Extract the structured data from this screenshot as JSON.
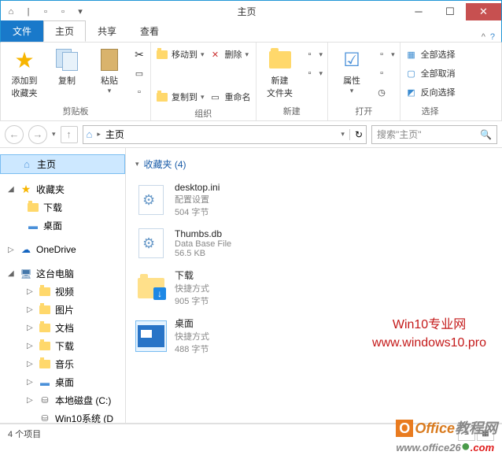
{
  "window": {
    "title": "主页"
  },
  "tabs": {
    "file": "文件",
    "home": "主页",
    "share": "共享",
    "view": "查看"
  },
  "ribbon": {
    "clipboard": {
      "label": "剪贴板",
      "pin": "添加到\n收藏夹",
      "copy": "复制",
      "paste": "粘贴"
    },
    "organize": {
      "label": "组织",
      "moveto": "移动到",
      "copyto": "复制到",
      "delete": "删除",
      "rename": "重命名"
    },
    "new": {
      "label": "新建",
      "newfolder": "新建\n文件夹"
    },
    "open": {
      "label": "打开",
      "properties": "属性"
    },
    "select": {
      "label": "选择",
      "selectall": "全部选择",
      "selectnone": "全部取消",
      "invert": "反向选择"
    }
  },
  "nav": {
    "location": "主页",
    "search_placeholder": "搜索\"主页\""
  },
  "tree": {
    "home": "主页",
    "favorites": "收藏夹",
    "downloads": "下载",
    "desktop": "桌面",
    "onedrive": "OneDrive",
    "thispc": "这台电脑",
    "videos": "视频",
    "pictures": "图片",
    "documents": "文档",
    "downloads2": "下载",
    "music": "音乐",
    "desktop2": "桌面",
    "localdisk": "本地磁盘 (C:)",
    "win10sys": "Win10系统 (D"
  },
  "content": {
    "section": "收藏夹 (4)",
    "files": [
      {
        "name": "desktop.ini",
        "type": "配置设置",
        "size": "504 字节"
      },
      {
        "name": "Thumbs.db",
        "type": "Data Base File",
        "size": "56.5 KB"
      },
      {
        "name": "下载",
        "type": "快捷方式",
        "size": "905 字节"
      },
      {
        "name": "桌面",
        "type": "快捷方式",
        "size": "488 字节"
      }
    ]
  },
  "watermark": {
    "line1": "Win10专业网",
    "line2": "www.windows10.pro"
  },
  "officewm": {
    "t1": "Office",
    "t2": "教程网",
    "url1": "www.office26",
    "url2": ".com"
  },
  "status": {
    "items": "4 个项目"
  }
}
